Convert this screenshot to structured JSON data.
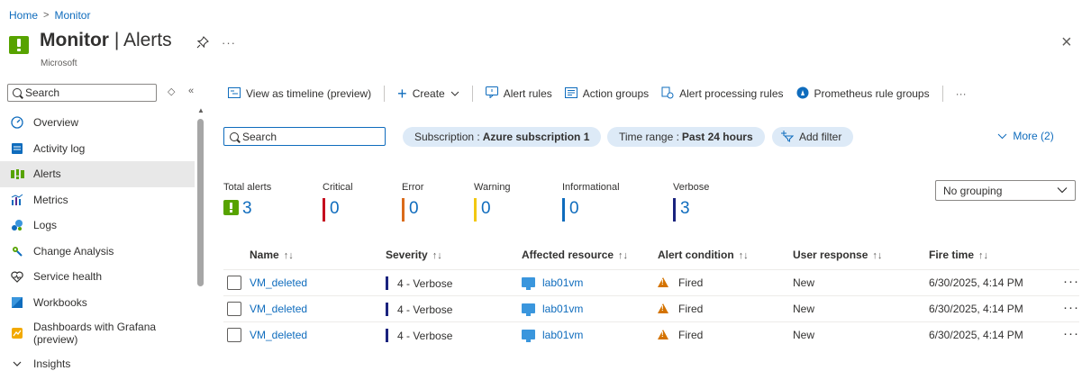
{
  "breadcrumb": {
    "home": "Home",
    "separator": ">",
    "current": "Monitor"
  },
  "header": {
    "title_bold": "Monitor",
    "title_sep": " | ",
    "title_page": "Alerts",
    "subtitle": "Microsoft",
    "pin_icon": "pin-icon",
    "more": "···",
    "close": "×"
  },
  "sidebar": {
    "search_placeholder": "Search",
    "items": [
      {
        "label": "Overview",
        "icon": "overview-icon"
      },
      {
        "label": "Activity log",
        "icon": "activity-log-icon"
      },
      {
        "label": "Alerts",
        "icon": "alerts-icon",
        "active": true
      },
      {
        "label": "Metrics",
        "icon": "metrics-icon"
      },
      {
        "label": "Logs",
        "icon": "logs-icon"
      },
      {
        "label": "Change Analysis",
        "icon": "change-analysis-icon"
      },
      {
        "label": "Service health",
        "icon": "service-health-icon"
      },
      {
        "label": "Workbooks",
        "icon": "workbooks-icon"
      },
      {
        "label": "Dashboards with Grafana (preview)",
        "icon": "grafana-icon"
      },
      {
        "label": "Insights",
        "icon": "chevron-down-icon"
      }
    ]
  },
  "toolbar": {
    "timeline": "View as timeline (preview)",
    "create": "Create",
    "alert_rules": "Alert rules",
    "action_groups": "Action groups",
    "processing_rules": "Alert processing rules",
    "prometheus": "Prometheus rule groups",
    "more": "···"
  },
  "filters": {
    "search_placeholder": "Search",
    "subscription_label": "Subscription :",
    "subscription_value": "Azure subscription 1",
    "time_label": "Time range :",
    "time_value": "Past 24 hours",
    "add_filter": "Add filter",
    "more": "More (2)"
  },
  "summary": {
    "total": {
      "label": "Total alerts",
      "value": "3"
    },
    "critical": {
      "label": "Critical",
      "value": "0",
      "color": "#c50f1f"
    },
    "error": {
      "label": "Error",
      "value": "0",
      "color": "#da6b1b"
    },
    "warning": {
      "label": "Warning",
      "value": "0",
      "color": "#f2c811"
    },
    "informational": {
      "label": "Informational",
      "value": "0",
      "color": "#0f6cbd"
    },
    "verbose": {
      "label": "Verbose",
      "value": "3",
      "color": "#1a237e"
    }
  },
  "grouping": {
    "selected": "No grouping"
  },
  "table": {
    "columns": [
      "Name",
      "Severity",
      "Affected resource",
      "Alert condition",
      "User response",
      "Fire time"
    ],
    "sort_glyph": "↑↓",
    "rows": [
      {
        "name": "VM_deleted",
        "severity": "4 - Verbose",
        "resource": "lab01vm",
        "condition": "Fired",
        "response": "New",
        "time": "6/30/2025, 4:14 PM"
      },
      {
        "name": "VM_deleted",
        "severity": "4 - Verbose",
        "resource": "lab01vm",
        "condition": "Fired",
        "response": "New",
        "time": "6/30/2025, 4:14 PM"
      },
      {
        "name": "VM_deleted",
        "severity": "4 - Verbose",
        "resource": "lab01vm",
        "condition": "Fired",
        "response": "New",
        "time": "6/30/2025, 4:14 PM"
      }
    ],
    "row_more": "···"
  }
}
